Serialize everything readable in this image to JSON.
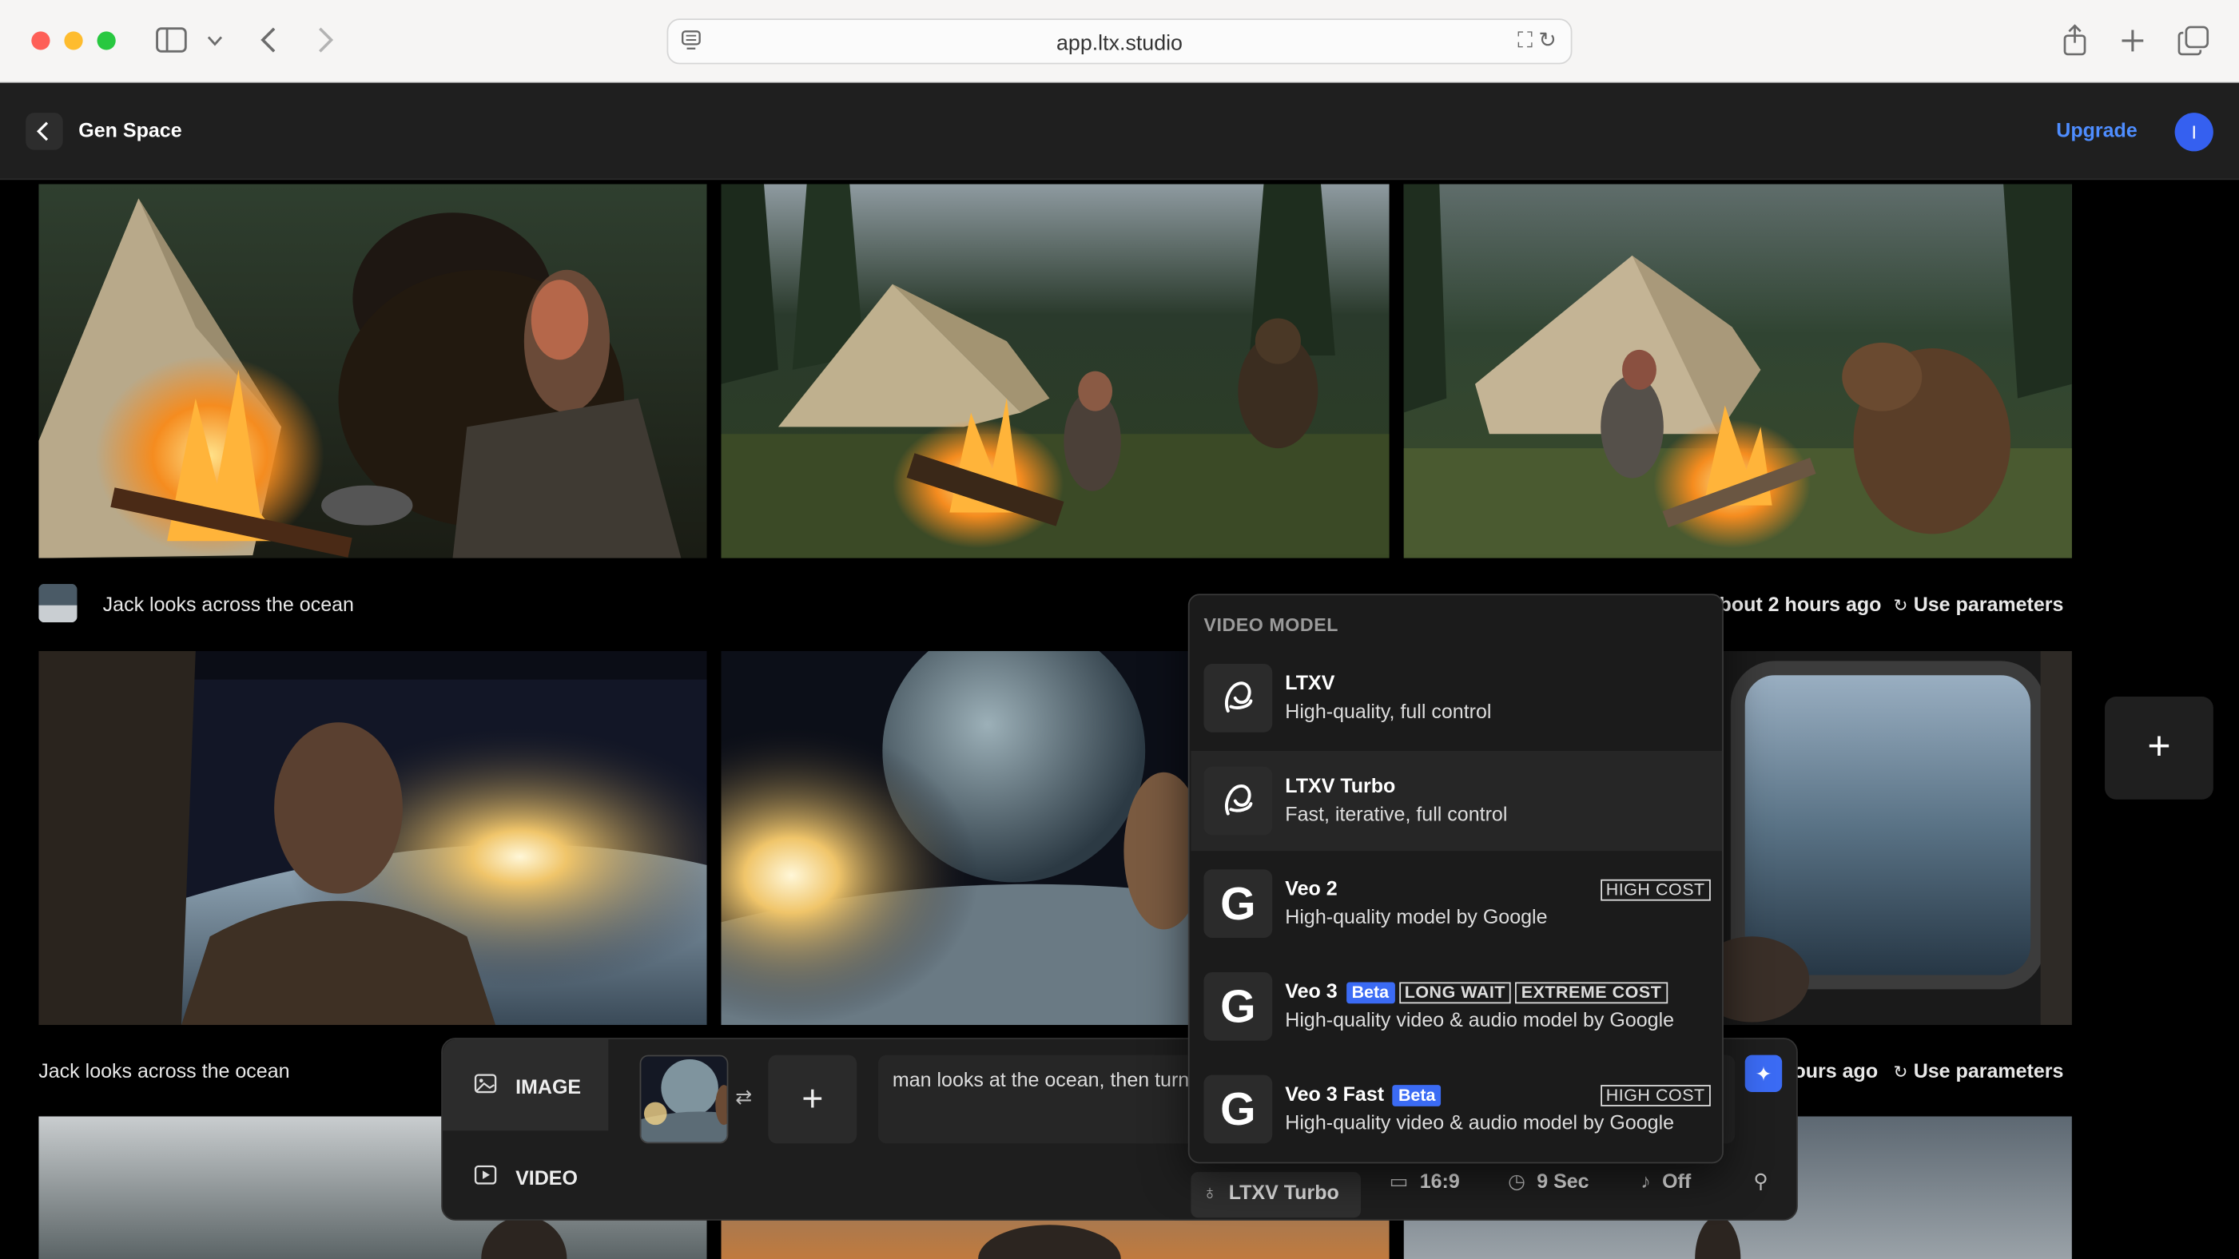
{
  "browser": {
    "url": "app.ltx.studio"
  },
  "header": {
    "title": "Gen Space",
    "upgrade_label": "Upgrade",
    "avatar_initial": "I"
  },
  "gallery": {
    "rows": [
      {
        "caption": "Jack looks across the ocean",
        "time": "bout 2 hours ago",
        "use_parameters": "Use parameters"
      },
      {
        "caption": "Jack looks across the ocean",
        "time": "ours ago",
        "use_parameters": "Use parameters"
      }
    ]
  },
  "composer": {
    "mode_image": "IMAGE",
    "mode_video": "VIDEO",
    "prompt": "man looks at the ocean, then turn",
    "options": {
      "model": "LTXV Turbo",
      "aspect": "16:9",
      "duration": "9 Sec",
      "audio": "Off"
    }
  },
  "dropdown": {
    "heading": "VIDEO MODEL",
    "items": [
      {
        "name": "LTXV",
        "desc": "High-quality, full control",
        "logo": "ltx-logo-icon"
      },
      {
        "name": "LTXV Turbo",
        "desc": "Fast, iterative, full control",
        "logo": "ltx-logo-icon",
        "selected": true
      },
      {
        "name": "Veo 2",
        "desc": "High-quality model by Google",
        "logo": "google-g-icon",
        "tags": [
          "HIGH COST"
        ]
      },
      {
        "name": "Veo 3",
        "desc": "High-quality video & audio model by Google",
        "logo": "google-g-icon",
        "beta": "Beta",
        "tags": [
          "LONG WAIT",
          "EXTREME COST"
        ]
      },
      {
        "name": "Veo 3 Fast",
        "desc": "High-quality video & audio model by Google",
        "logo": "google-g-icon",
        "beta": "Beta",
        "tags": [
          "HIGH COST"
        ]
      }
    ],
    "google_letter": "G"
  },
  "colors": {
    "accent": "#3b6bf4",
    "upgrade": "#4e8dff",
    "panel": "#1b1b1b"
  }
}
